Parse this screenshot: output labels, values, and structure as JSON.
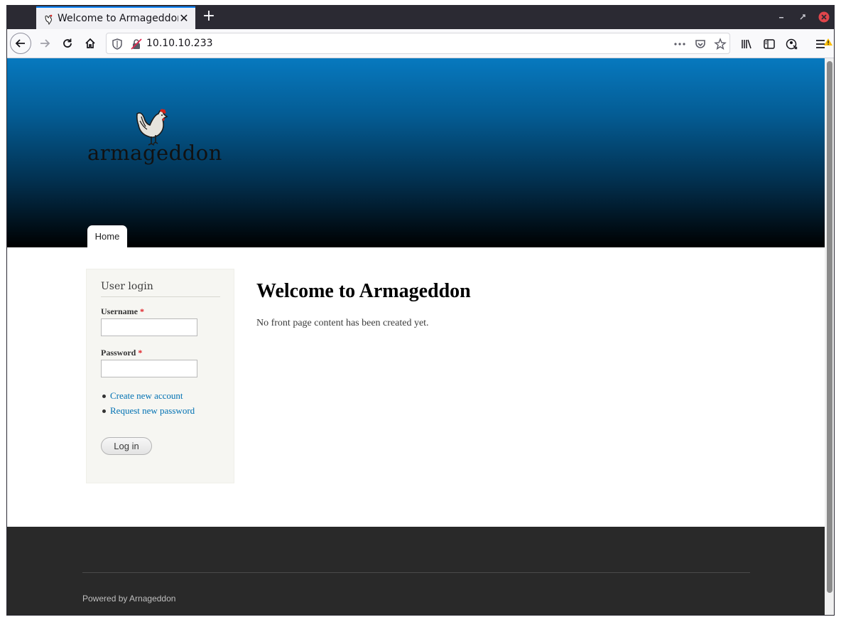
{
  "browser": {
    "tab_title": "Welcome to Armageddon",
    "tab_close": "✕",
    "new_tab": "+",
    "url": "10.10.10.233"
  },
  "site": {
    "logo_text": "armageddon",
    "nav": {
      "home": "Home"
    }
  },
  "login": {
    "block_title": "User login",
    "username_label": "Username",
    "password_label": "Password",
    "required_mark": "*",
    "username_value": "",
    "password_value": "",
    "links": [
      "Create new account",
      "Request new password"
    ],
    "login_button": "Log in"
  },
  "main": {
    "title": "Welcome to Armageddon",
    "body": "No front page content has been created yet."
  },
  "footer": {
    "text": "Powered by Arnageddon"
  },
  "colors": {
    "header_top": "#0779bf",
    "header_bottom": "#000000",
    "link": "#0071b3",
    "footer_bg": "#292929",
    "tab_accent": "#0a84ff"
  }
}
